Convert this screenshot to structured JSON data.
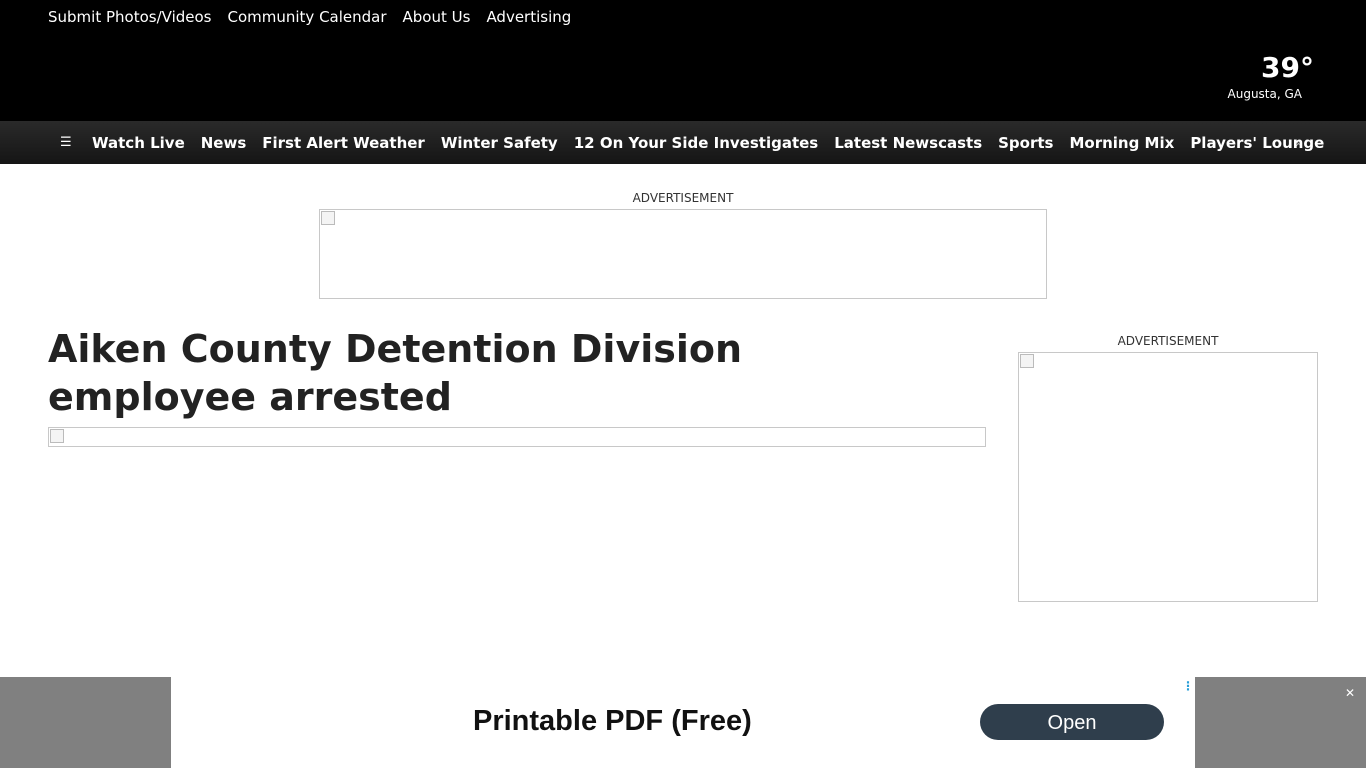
{
  "header": {
    "utility_links": [
      "Submit Photos/Videos",
      "Community Calendar",
      "About Us",
      "Advertising"
    ],
    "weather": {
      "temperature": "39°",
      "location": "Augusta, GA"
    }
  },
  "nav": {
    "menu_icon": "menu-icon",
    "items": [
      "Watch Live",
      "News",
      "First Alert Weather",
      "Winter Safety",
      "12 On Your Side Investigates",
      "Latest Newscasts",
      "Sports",
      "Morning Mix",
      "Players' Lounge"
    ],
    "search_icon": "search-icon"
  },
  "ads": {
    "top_label": "ADVERTISEMENT",
    "side_label": "ADVERTISEMENT"
  },
  "article": {
    "title": "Aiken County Detention Division employee arrested"
  },
  "bottom_ad": {
    "headline": "Printable PDF (Free)",
    "button_label": "Open",
    "button_color": "#2f3e4c"
  },
  "icons": {
    "menu": "☰",
    "search": "⌕",
    "adchoice": "⋮",
    "close": "✕"
  }
}
